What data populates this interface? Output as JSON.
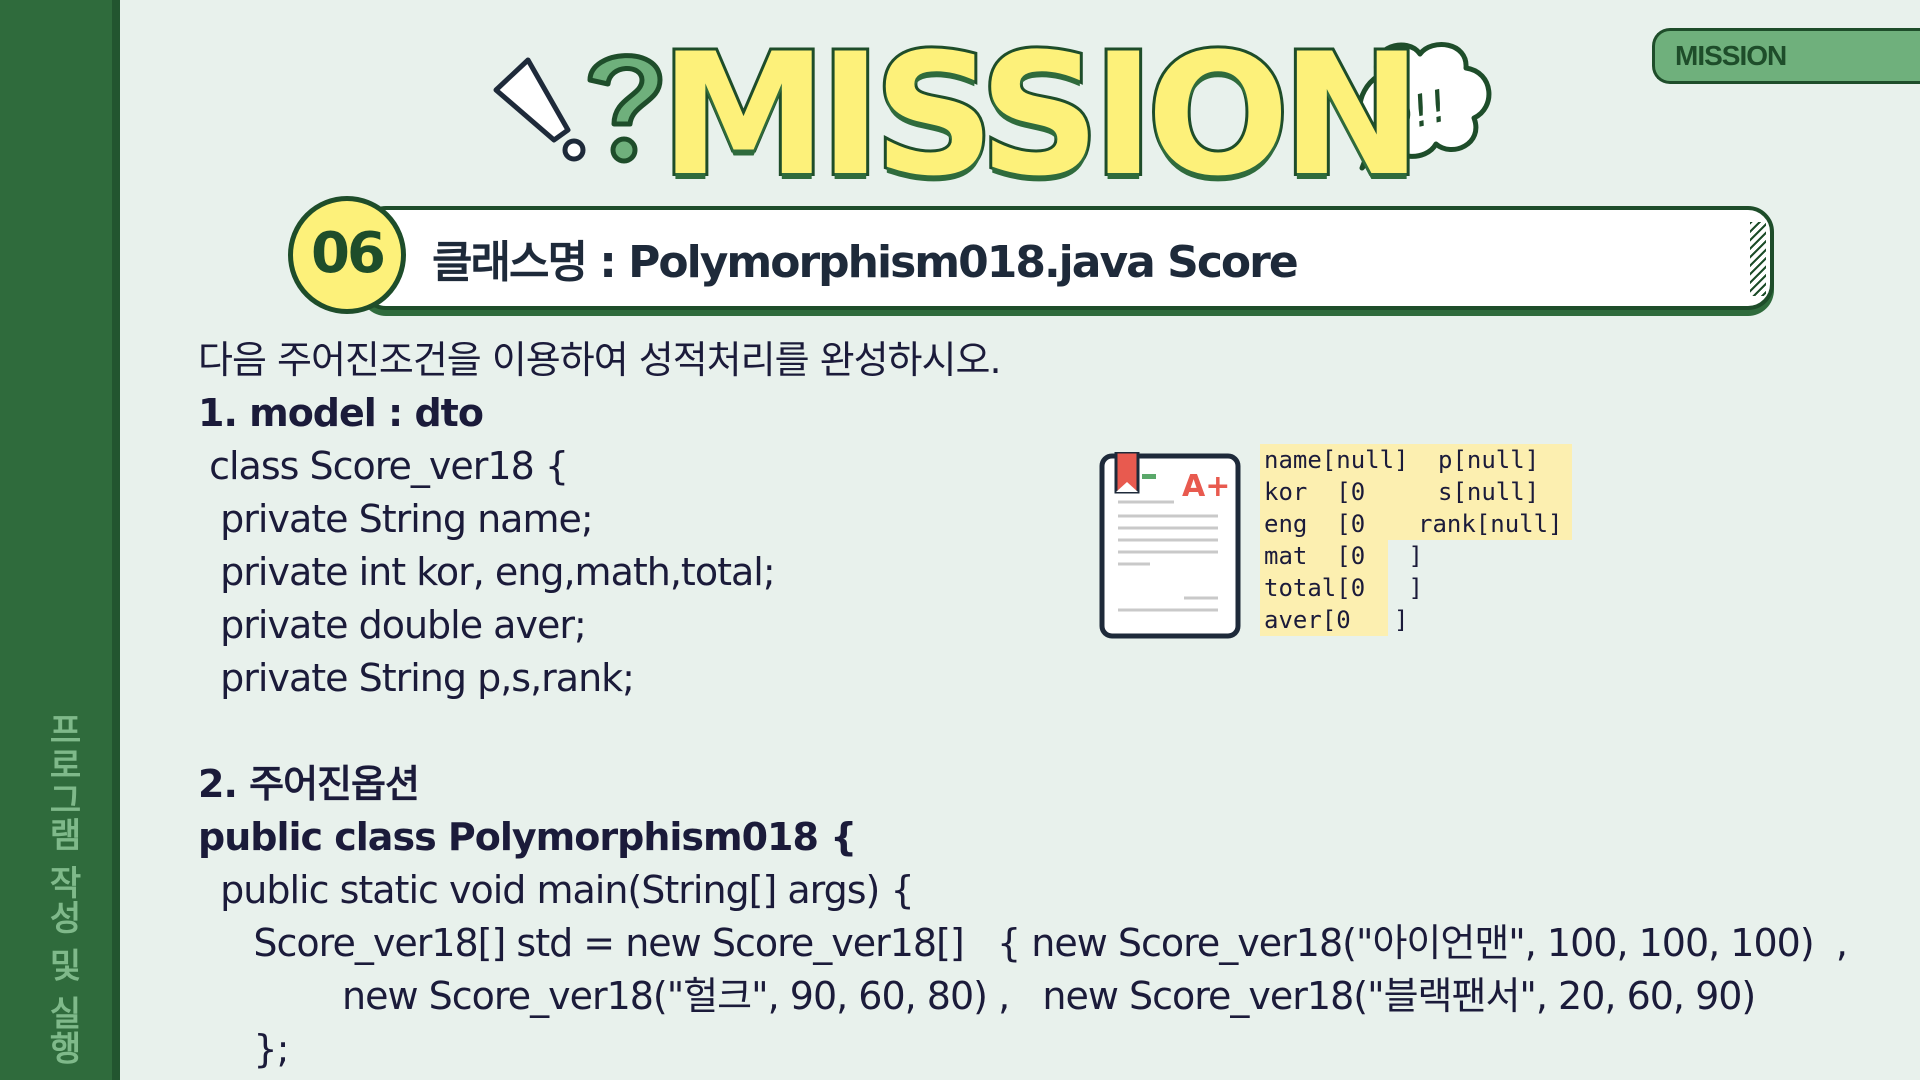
{
  "sidebar": {
    "vertical_title": "프로그램 작성 및 실행"
  },
  "tag": {
    "label": "MISSION"
  },
  "header": {
    "title": "MISSION",
    "bubble_text": "Q!!",
    "number": "06",
    "class_label": "클래스명 : Polymorphism018.java   Score"
  },
  "content": {
    "lines": [
      {
        "text": "다음 주어진조건을 이용하여 성적처리를 완성하시오.",
        "bold": false,
        "indent": 0
      },
      {
        "text": "1. model : dto",
        "bold": true,
        "indent": 0
      },
      {
        "text": " class Score_ver18 {",
        "bold": false,
        "indent": 0
      },
      {
        "text": "  private String name;",
        "bold": false,
        "indent": 0
      },
      {
        "text": "  private int kor, eng,math,total;",
        "bold": false,
        "indent": 0
      },
      {
        "text": "  private double aver;",
        "bold": false,
        "indent": 0
      },
      {
        "text": "  private String p,s,rank;",
        "bold": false,
        "indent": 0
      },
      {
        "text": "",
        "bold": false,
        "indent": 0
      },
      {
        "text": "2. 주어진옵션",
        "bold": true,
        "indent": 0
      },
      {
        "text": "public class Polymorphism018 {",
        "bold": true,
        "indent": 0
      },
      {
        "text": "  public static void main(String[] args) {",
        "bold": false,
        "indent": 0
      },
      {
        "text": "     Score_ver18[] std = new Score_ver18[]   { new Score_ver18(\"아이언맨\", 100, 100, 100)  ,",
        "bold": false,
        "indent": 0
      },
      {
        "text": "             new Score_ver18(\"헐크\", 90, 60, 80) ,   new Score_ver18(\"블랙팬서\", 20, 60, 90)",
        "bold": false,
        "indent": 0
      },
      {
        "text": "     };",
        "bold": false,
        "indent": 0
      }
    ]
  },
  "doc_icon": {
    "grade": "A+"
  },
  "fields": {
    "rows": [
      {
        "left": "name[null]",
        "right": "p[null]"
      },
      {
        "left": "kor  [0   ]",
        "right": "s[null]"
      },
      {
        "left": "eng  [0   ]",
        "right": "rank[null]"
      },
      {
        "left": "mat  [0   ]",
        "right": ""
      },
      {
        "left": "total[0   ]",
        "right": ""
      },
      {
        "left": "aver[0   ]",
        "right": ""
      }
    ]
  },
  "colors": {
    "sidebar": "#2f6b3c",
    "title_fill": "#fdf17a",
    "title_stroke": "#1e4d2a",
    "background": "#e8f1ec",
    "highlight": "#fcefb0"
  }
}
